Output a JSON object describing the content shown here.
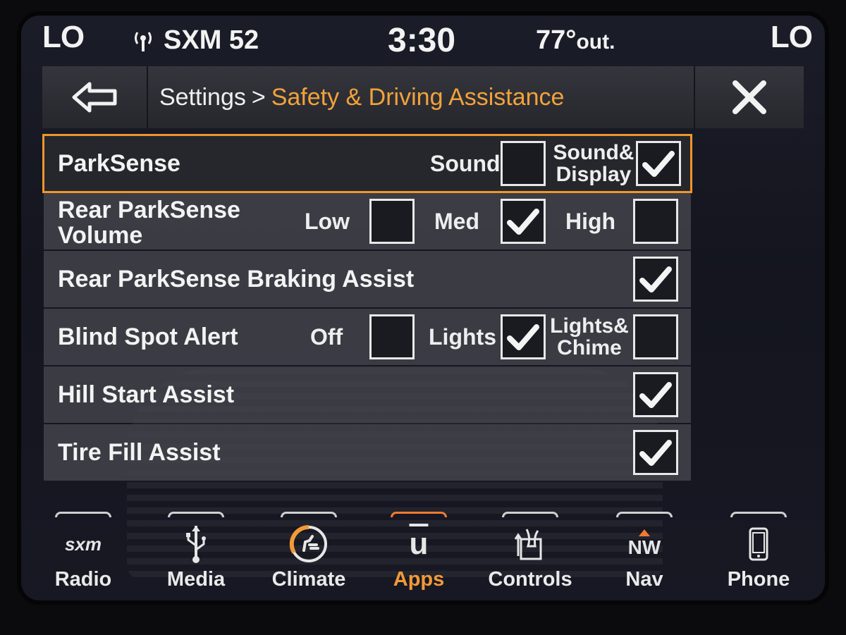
{
  "status_bar": {
    "left_temp": "LO",
    "right_temp": "LO",
    "station": "SXM 52",
    "clock": "3:30",
    "outside_temp": "77°",
    "outside_unit": "out."
  },
  "header": {
    "crumb": "Settings",
    "separator": ">",
    "current": "Safety & Driving Assistance"
  },
  "rows": [
    {
      "label": "ParkSense",
      "options": [
        {
          "label": "Sound",
          "checked": false
        },
        {
          "label": "Sound& Display",
          "checked": true
        }
      ]
    },
    {
      "label": "Rear ParkSense Volume",
      "options": [
        {
          "label": "Low",
          "checked": false
        },
        {
          "label": "Med",
          "checked": true
        },
        {
          "label": "High",
          "checked": false
        }
      ]
    },
    {
      "label": "Rear ParkSense Braking Assist",
      "checked": true
    },
    {
      "label": "Blind Spot Alert",
      "options": [
        {
          "label": "Off",
          "checked": false
        },
        {
          "label": "Lights",
          "checked": true
        },
        {
          "label": "Lights& Chime",
          "checked": false
        }
      ]
    },
    {
      "label": "Hill Start Assist",
      "checked": true
    },
    {
      "label": "Tire Fill Assist",
      "checked": true
    }
  ],
  "dock": [
    {
      "label": "Radio",
      "icon_text": "sxm",
      "icon": "sxm-icon"
    },
    {
      "label": "Media",
      "icon": "usb-icon"
    },
    {
      "label": "Climate",
      "icon": "climate-icon"
    },
    {
      "label": "Apps",
      "icon_text": "u",
      "icon": "apps-icon",
      "active": true
    },
    {
      "label": "Controls",
      "icon": "controls-icon"
    },
    {
      "label": "Nav",
      "icon_text": "NW",
      "icon": "compass-icon"
    },
    {
      "label": "Phone",
      "icon": "phone-icon"
    }
  ],
  "colors": {
    "accent": "#f2a23a",
    "active_tab": "#f07a30"
  }
}
